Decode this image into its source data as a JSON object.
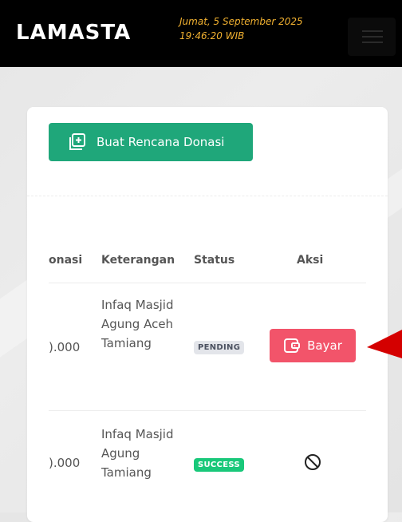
{
  "header": {
    "logo": "LAMASTA",
    "date": "Jumat, 5 September 2025",
    "time": "19:46:20 WIB"
  },
  "actions": {
    "create_label": "Buat Rencana Donasi"
  },
  "table": {
    "columns": [
      "onasi",
      "Keterangan",
      "Status",
      "Aksi"
    ],
    "rows": [
      {
        "donasi": ").000",
        "keterangan": "Infaq Masjid Agung Aceh Tamiang",
        "status": "PENDING",
        "action_label": "Bayar"
      },
      {
        "donasi": ").000",
        "keterangan": "Infaq Masjid Agung Tamiang",
        "status": "SUCCESS"
      }
    ]
  },
  "colors": {
    "header_bg": "#000000",
    "datetime": "#f0b030",
    "primary": "#1fa77a",
    "danger": "#f2546a",
    "success": "#19c87a",
    "pending_bg": "#e3e5ea",
    "annotation": "#d40000"
  },
  "icons": {
    "create": "plus-square-icon",
    "pay": "wallet-icon",
    "disabled": "ban-icon",
    "menu": "hamburger-icon",
    "annotation": "arrow-left-icon"
  }
}
